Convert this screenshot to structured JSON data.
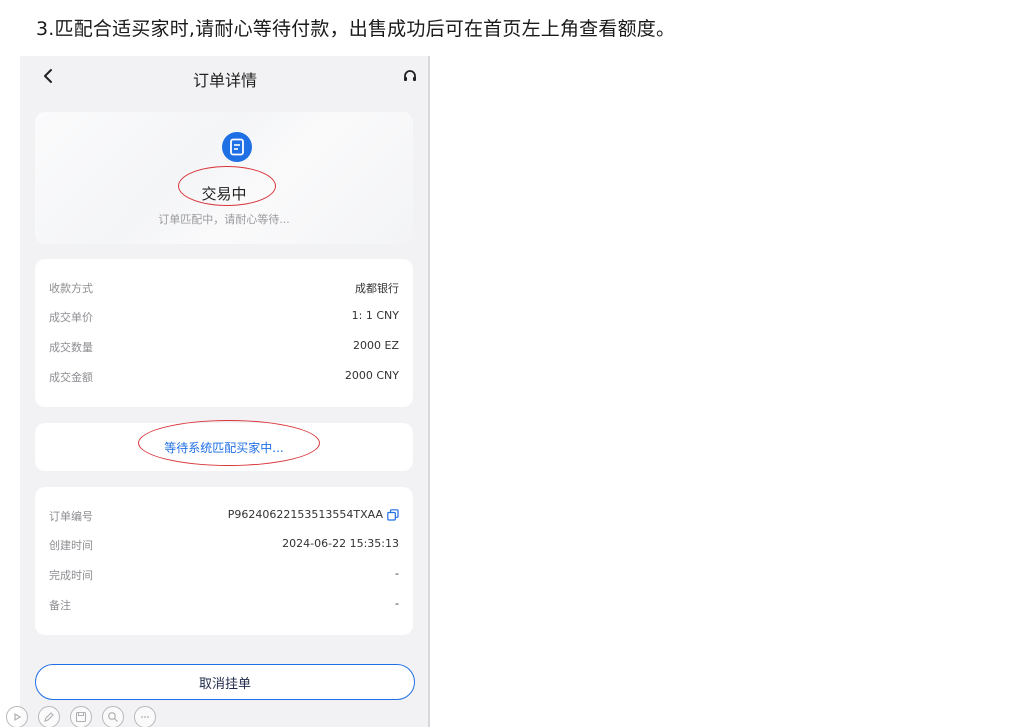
{
  "instruction": "3.匹配合适买家时,请耐心等待付款，出售成功后可在首页左上角查看额度。",
  "nav": {
    "title": "订单详情",
    "back_icon": "chevron-left-icon",
    "support_icon": "headset-icon"
  },
  "status": {
    "icon": "document-icon",
    "title": "交易中",
    "subtitle": "订单匹配中，请耐心等待..."
  },
  "trade_info": [
    {
      "label": "收款方式",
      "value": "成都银行"
    },
    {
      "label": "成交单价",
      "value": "1: 1 CNY"
    },
    {
      "label": "成交数量",
      "value": "2000 EZ"
    },
    {
      "label": "成交金额",
      "value": "2000 CNY"
    }
  ],
  "waiting_text": "等待系统匹配买家中...",
  "order_details": [
    {
      "label": "订单编号",
      "value": "P96240622153513554TXAA"
    },
    {
      "label": "创建时间",
      "value": "2024-06-22 15:35:13"
    },
    {
      "label": "完成时间",
      "value": "-"
    },
    {
      "label": "备注",
      "value": "-"
    }
  ],
  "cancel_button": "取消挂单",
  "colors": {
    "accent": "#1f6fe5",
    "annotation": "#d9353a",
    "page_bg": "#f2f2f4"
  }
}
